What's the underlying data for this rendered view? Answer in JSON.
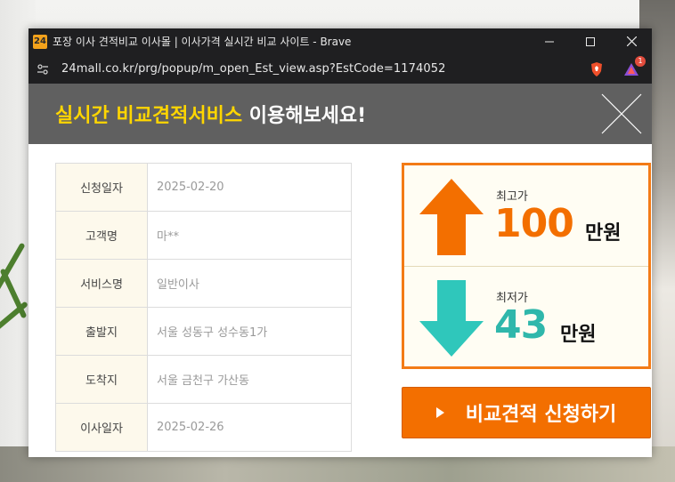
{
  "window": {
    "title": "포장 이사 견적비교 이사몰 | 이사가격 실시간 비교 사이트 - Brave",
    "app_logo": "24"
  },
  "address": {
    "url": "24mall.co.kr/prg/popup/m_open_Est_view.asp?EstCode=1174052",
    "rewards_badge": "1"
  },
  "banner": {
    "highlight": "실시간 비교견적서비스",
    "rest": " 이용해보세요!"
  },
  "info_rows": [
    {
      "label": "신청일자",
      "value": "2025-02-20"
    },
    {
      "label": "고객명",
      "value": "마**"
    },
    {
      "label": "서비스명",
      "value": "일반이사"
    },
    {
      "label": "출발지",
      "value": "서울 성동구 성수동1가"
    },
    {
      "label": "도착지",
      "value": "서울 금천구 가산동"
    },
    {
      "label": "이사일자",
      "value": "2025-02-26"
    }
  ],
  "price": {
    "max_label": "최고가",
    "max_value": "100",
    "min_label": "최저가",
    "min_value": "43",
    "unit": "만원"
  },
  "apply_button": "비교견적 신청하기",
  "colors": {
    "accent_orange": "#f36f00",
    "accent_teal": "#2fb7ab",
    "highlight_yellow": "#ffd600"
  }
}
